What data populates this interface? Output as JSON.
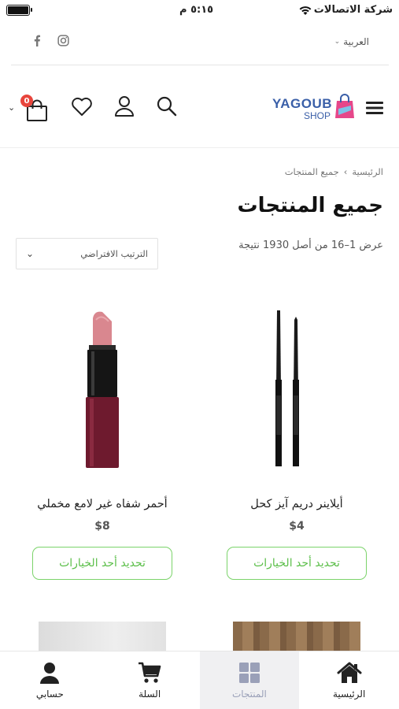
{
  "status_bar": {
    "carrier": "شركة الاتصالات",
    "time": "٥:١٥ م"
  },
  "topbar": {
    "language": "العربية",
    "social": [
      "facebook-icon",
      "instagram-icon"
    ]
  },
  "header": {
    "logo_main": "YAGOUB",
    "logo_sub": "SHOP",
    "cart_count": "0"
  },
  "breadcrumb": {
    "home": "الرئيسية",
    "separator": "›",
    "current": "جميع المنتجات"
  },
  "page": {
    "title": "جميع المنتجات",
    "result_count": "عرض 1–16 من أصل 1930 نتيجة"
  },
  "sort": {
    "selected": "الترتيب الافتراضي"
  },
  "products": [
    {
      "name": "أحمر شفاه غير لامع مخملي",
      "price": "$8",
      "button": "تحديد أحد الخيارات"
    },
    {
      "name": "أيلاينر دريم آيز كحل",
      "price": "$4",
      "button": "تحديد أحد الخيارات"
    }
  ],
  "tabbar": [
    {
      "label": "حسابي",
      "icon": "user-icon"
    },
    {
      "label": "السلة",
      "icon": "cart-icon"
    },
    {
      "label": "المنتجات",
      "icon": "grid-icon",
      "active": true
    },
    {
      "label": "الرئيسية",
      "icon": "home-icon"
    }
  ],
  "colors": {
    "accent_green": "#5cbf4a",
    "badge_red": "#e8453c",
    "logo_blue": "#3a5fa8",
    "logo_pink": "#e6478a"
  }
}
